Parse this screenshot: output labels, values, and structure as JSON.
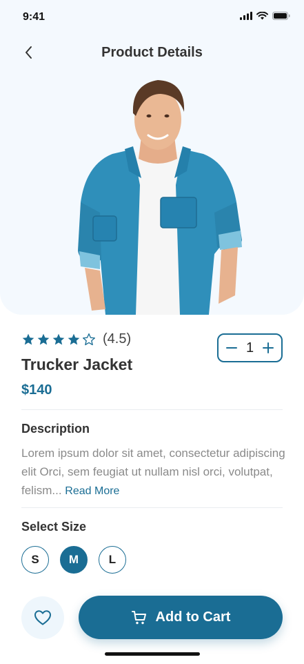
{
  "status_bar": {
    "time": "9:41"
  },
  "header": {
    "title": "Product Details"
  },
  "product": {
    "rating_text": "(4.5)",
    "rating_value": 4.5,
    "stars_total": 5,
    "name": "Trucker Jacket",
    "price": "$140",
    "quantity": "1"
  },
  "description": {
    "title": "Description",
    "text": "Lorem ipsum dolor sit amet, consectetur adipiscing elit Orci, sem feugiat ut nullam nisl orci, volutpat, felism...",
    "read_more": "Read More"
  },
  "size": {
    "title": "Select Size",
    "options": [
      "S",
      "M",
      "L"
    ],
    "selected": "M"
  },
  "actions": {
    "add_to_cart": "Add to Cart",
    "favorite_icon": "heart-icon",
    "cart_icon": "cart-icon"
  },
  "colors": {
    "accent": "#1a6d94",
    "hero_bg": "#f4f9fe",
    "jacket": "#2f8fba"
  }
}
